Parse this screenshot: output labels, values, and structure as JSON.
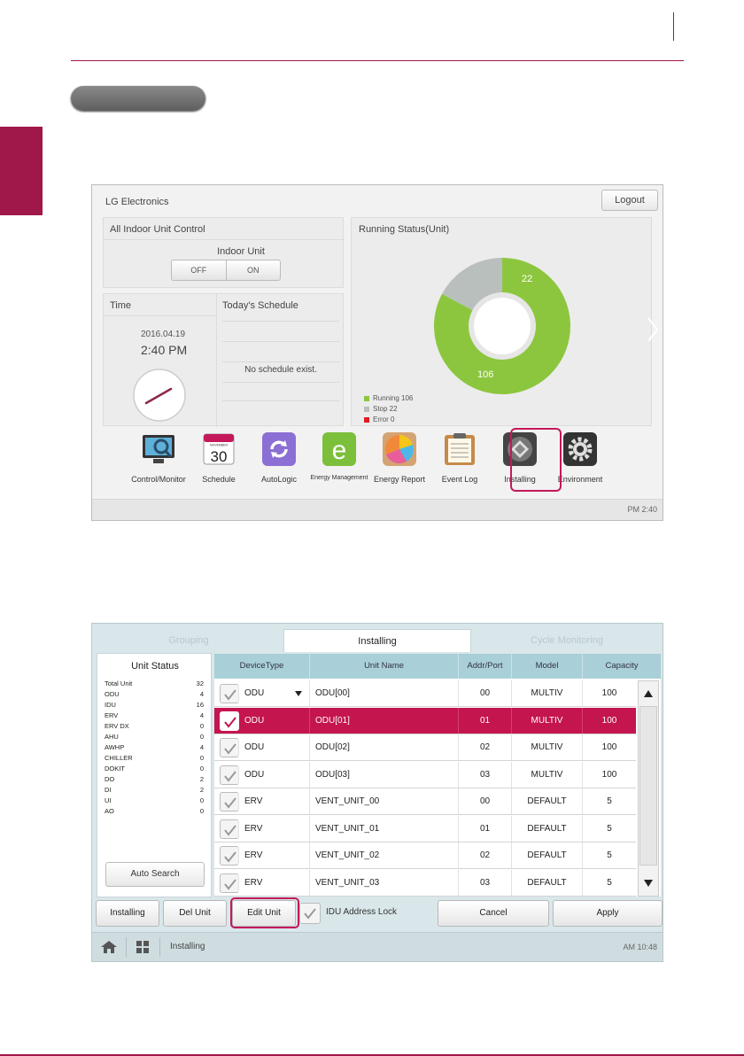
{
  "screen1": {
    "brand": "LG Electronics",
    "logout_label": "Logout",
    "all_indoor_title": "All Indoor Unit Control",
    "indoor_unit_label": "Indoor Unit",
    "off_label": "OFF",
    "on_label": "ON",
    "time_title": "Time",
    "date": "2016.04.19",
    "time": "2:40 PM",
    "schedule_title": "Today's Schedule",
    "no_schedule": "No schedule exist.",
    "running_status_title": "Running Status(Unit)",
    "donut_running_value": "106",
    "donut_stop_value": "22",
    "chart_data": {
      "type": "pie",
      "categories": [
        "Running",
        "Stop",
        "Error"
      ],
      "values": [
        106,
        22,
        0
      ]
    },
    "legend": {
      "running": "Running 106",
      "stop": "Stop 22",
      "error": "Error 0"
    },
    "apps": [
      {
        "label": "Control/Monitor"
      },
      {
        "label": "Schedule"
      },
      {
        "label": "AutoLogic"
      },
      {
        "label": "Energy Management"
      },
      {
        "label": "Energy Report"
      },
      {
        "label": "Event Log"
      },
      {
        "label": "Installing"
      },
      {
        "label": "Environment"
      }
    ],
    "calendar_month": "NOVEMBER",
    "calendar_day": "30",
    "clock": "PM 2:40",
    "colors": {
      "running": "#8cc63e",
      "stop": "#b9bfbd",
      "error": "#e21b23",
      "highlight": "#c4185a"
    }
  },
  "screen2": {
    "tabs": [
      "Grouping",
      "Installing",
      "Cycle Monitoring"
    ],
    "unit_status_title": "Unit Status",
    "unit_status": [
      {
        "label": "Total Unit",
        "value": "32"
      },
      {
        "label": "ODU",
        "value": "4"
      },
      {
        "label": "IDU",
        "value": "16"
      },
      {
        "label": "ERV",
        "value": "4"
      },
      {
        "label": "ERV DX",
        "value": "0"
      },
      {
        "label": "AHU",
        "value": "0"
      },
      {
        "label": "AWHP",
        "value": "4"
      },
      {
        "label": "CHILLER",
        "value": "0"
      },
      {
        "label": "DOKIT",
        "value": "0"
      },
      {
        "label": "DO",
        "value": "2"
      },
      {
        "label": "DI",
        "value": "2"
      },
      {
        "label": "UI",
        "value": "0"
      },
      {
        "label": "AO",
        "value": "0"
      }
    ],
    "auto_search_label": "Auto Search",
    "columns": [
      "DeviceType",
      "Unit Name",
      "Addr/Port",
      "Model",
      "Capacity"
    ],
    "rows": [
      {
        "type": "ODU",
        "name": "ODU[00]",
        "addr": "00",
        "model": "MULTIV",
        "capacity": "100"
      },
      {
        "type": "ODU",
        "name": "ODU[01]",
        "addr": "01",
        "model": "MULTIV",
        "capacity": "100"
      },
      {
        "type": "ODU",
        "name": "ODU[02]",
        "addr": "02",
        "model": "MULTIV",
        "capacity": "100"
      },
      {
        "type": "ODU",
        "name": "ODU[03]",
        "addr": "03",
        "model": "MULTIV",
        "capacity": "100"
      },
      {
        "type": "ERV",
        "name": "VENT_UNIT_00",
        "addr": "00",
        "model": "DEFAULT",
        "capacity": "5"
      },
      {
        "type": "ERV",
        "name": "VENT_UNIT_01",
        "addr": "01",
        "model": "DEFAULT",
        "capacity": "5"
      },
      {
        "type": "ERV",
        "name": "VENT_UNIT_02",
        "addr": "02",
        "model": "DEFAULT",
        "capacity": "5"
      },
      {
        "type": "ERV",
        "name": "VENT_UNIT_03",
        "addr": "03",
        "model": "DEFAULT",
        "capacity": "5"
      }
    ],
    "buttons": {
      "installing": "Installing",
      "del_unit": "Del Unit",
      "edit_unit": "Edit Unit",
      "idu_lock": "IDU Address Lock",
      "cancel": "Cancel",
      "apply": "Apply"
    },
    "breadcrumb": "Installing",
    "clock": "AM 10:48"
  }
}
